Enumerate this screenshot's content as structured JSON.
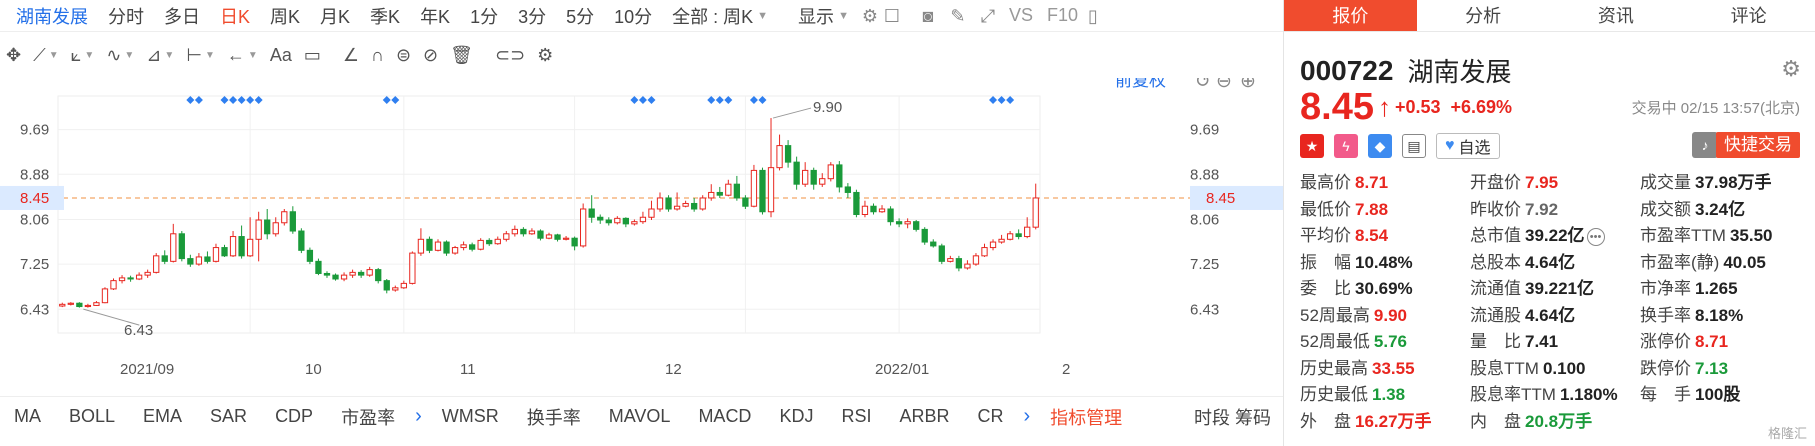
{
  "period_bar": {
    "stock_name": "湖南发展",
    "items": [
      "分时",
      "多日",
      "日K",
      "周K",
      "月K",
      "季K",
      "年K",
      "1分",
      "3分",
      "5分",
      "10分"
    ],
    "active": "日K",
    "adjust_select": "全部 : 周K",
    "display_label": "显示",
    "vs_label": "VS",
    "f10_label": "F10"
  },
  "toolbar": {
    "text_tool": "Aa"
  },
  "chart": {
    "adjust_label": "前复权",
    "y_ticks": [
      "9.69",
      "8.88",
      "8.06",
      "7.25",
      "6.43"
    ],
    "current_price": "8.45",
    "x_labels": [
      "2021/09",
      "10",
      "11",
      "12",
      "2022/01",
      "2"
    ],
    "high_marker": "9.90",
    "low_marker": "6.43"
  },
  "chart_data": {
    "type": "candlestick",
    "ylim": [
      6.0,
      10.3
    ],
    "reference_price": 8.45,
    "annotations": {
      "max": 9.9,
      "min": 6.43
    },
    "candles": [
      [
        6.49,
        6.52,
        6.47,
        6.55
      ],
      [
        6.52,
        6.54,
        6.5,
        6.56
      ],
      [
        6.54,
        6.48,
        6.46,
        6.56
      ],
      [
        6.48,
        6.5,
        6.46,
        6.53
      ],
      [
        6.5,
        6.55,
        6.49,
        6.58
      ],
      [
        6.55,
        6.8,
        6.54,
        6.83
      ],
      [
        6.8,
        6.95,
        6.78,
        6.99
      ],
      [
        6.95,
        7.0,
        6.9,
        7.05
      ],
      [
        7.0,
        6.98,
        6.93,
        7.04
      ],
      [
        6.98,
        7.05,
        6.96,
        7.1
      ],
      [
        7.05,
        7.1,
        7.0,
        7.15
      ],
      [
        7.1,
        7.4,
        7.08,
        7.45
      ],
      [
        7.4,
        7.3,
        7.25,
        7.5
      ],
      [
        7.3,
        7.8,
        7.28,
        7.98
      ],
      [
        7.8,
        7.35,
        7.3,
        7.85
      ],
      [
        7.35,
        7.25,
        7.2,
        7.42
      ],
      [
        7.25,
        7.38,
        7.22,
        7.45
      ],
      [
        7.38,
        7.3,
        7.26,
        7.48
      ],
      [
        7.3,
        7.55,
        7.28,
        7.62
      ],
      [
        7.55,
        7.4,
        7.38,
        7.6
      ],
      [
        7.4,
        7.75,
        7.38,
        7.85
      ],
      [
        7.75,
        7.4,
        7.35,
        7.95
      ],
      [
        7.4,
        7.7,
        7.38,
        8.1
      ],
      [
        7.7,
        8.05,
        7.3,
        8.2
      ],
      [
        8.05,
        7.8,
        7.7,
        8.25
      ],
      [
        7.8,
        8.0,
        7.75,
        8.1
      ],
      [
        8.0,
        8.2,
        7.95,
        8.25
      ],
      [
        8.2,
        7.85,
        7.8,
        8.3
      ],
      [
        7.85,
        7.5,
        7.45,
        7.9
      ],
      [
        7.5,
        7.3,
        7.25,
        7.55
      ],
      [
        7.3,
        7.08,
        7.05,
        7.35
      ],
      [
        7.08,
        7.05,
        7.0,
        7.12
      ],
      [
        7.05,
        6.98,
        6.95,
        7.08
      ],
      [
        6.98,
        7.05,
        6.94,
        7.1
      ],
      [
        7.05,
        7.1,
        7.0,
        7.15
      ],
      [
        7.1,
        7.05,
        7.0,
        7.14
      ],
      [
        7.05,
        7.15,
        7.02,
        7.2
      ],
      [
        7.15,
        6.95,
        6.9,
        7.18
      ],
      [
        6.95,
        6.78,
        6.72,
        6.98
      ],
      [
        6.78,
        6.82,
        6.75,
        6.86
      ],
      [
        6.82,
        6.9,
        6.8,
        6.95
      ],
      [
        6.9,
        7.45,
        6.88,
        7.48
      ],
      [
        7.45,
        7.7,
        7.4,
        7.9
      ],
      [
        7.7,
        7.5,
        7.45,
        7.75
      ],
      [
        7.5,
        7.65,
        7.48,
        7.7
      ],
      [
        7.65,
        7.45,
        7.4,
        7.68
      ],
      [
        7.45,
        7.55,
        7.42,
        7.58
      ],
      [
        7.55,
        7.6,
        7.5,
        7.66
      ],
      [
        7.6,
        7.52,
        7.48,
        7.64
      ],
      [
        7.52,
        7.68,
        7.5,
        7.72
      ],
      [
        7.68,
        7.62,
        7.58,
        7.72
      ],
      [
        7.62,
        7.7,
        7.6,
        7.75
      ],
      [
        7.7,
        7.8,
        7.66,
        7.85
      ],
      [
        7.8,
        7.88,
        7.75,
        7.95
      ],
      [
        7.88,
        7.8,
        7.75,
        7.92
      ],
      [
        7.8,
        7.85,
        7.78,
        7.9
      ],
      [
        7.85,
        7.72,
        7.68,
        7.88
      ],
      [
        7.72,
        7.78,
        7.7,
        7.82
      ],
      [
        7.78,
        7.7,
        7.66,
        7.8
      ],
      [
        7.7,
        7.72,
        7.68,
        7.76
      ],
      [
        7.72,
        7.58,
        7.5,
        7.75
      ],
      [
        7.58,
        8.25,
        7.55,
        8.35
      ],
      [
        8.25,
        8.1,
        8.0,
        8.5
      ],
      [
        8.1,
        8.05,
        7.98,
        8.15
      ],
      [
        8.05,
        8.0,
        7.95,
        8.1
      ],
      [
        8.0,
        8.08,
        7.97,
        8.12
      ],
      [
        8.08,
        7.98,
        7.92,
        8.1
      ],
      [
        7.98,
        8.02,
        7.95,
        8.06
      ],
      [
        8.02,
        8.1,
        7.98,
        8.2
      ],
      [
        8.1,
        8.25,
        8.05,
        8.4
      ],
      [
        8.25,
        8.45,
        8.2,
        8.55
      ],
      [
        8.45,
        8.25,
        8.2,
        8.5
      ],
      [
        8.25,
        8.3,
        8.22,
        8.55
      ],
      [
        8.3,
        8.35,
        8.28,
        8.4
      ],
      [
        8.35,
        8.25,
        8.2,
        8.45
      ],
      [
        8.25,
        8.45,
        8.22,
        8.5
      ],
      [
        8.45,
        8.55,
        8.4,
        8.7
      ],
      [
        8.55,
        8.5,
        8.45,
        8.65
      ],
      [
        8.5,
        8.7,
        8.48,
        8.78
      ],
      [
        8.7,
        8.45,
        8.4,
        8.85
      ],
      [
        8.45,
        8.3,
        8.25,
        8.5
      ],
      [
        8.3,
        8.95,
        8.28,
        9.05
      ],
      [
        8.95,
        8.2,
        8.15,
        9.0
      ],
      [
        8.2,
        9.0,
        8.1,
        9.9
      ],
      [
        9.0,
        9.4,
        8.95,
        9.6
      ],
      [
        9.4,
        9.1,
        9.0,
        9.5
      ],
      [
        9.1,
        8.7,
        8.6,
        9.2
      ],
      [
        8.7,
        8.95,
        8.65,
        9.1
      ],
      [
        8.95,
        8.7,
        8.6,
        9.0
      ],
      [
        8.7,
        8.8,
        8.65,
        8.9
      ],
      [
        8.8,
        9.05,
        8.75,
        9.1
      ],
      [
        9.05,
        8.65,
        8.55,
        9.12
      ],
      [
        8.65,
        8.55,
        8.45,
        8.72
      ],
      [
        8.55,
        8.15,
        8.1,
        8.6
      ],
      [
        8.15,
        8.3,
        8.1,
        8.4
      ],
      [
        8.3,
        8.2,
        8.15,
        8.35
      ],
      [
        8.2,
        8.25,
        8.18,
        8.32
      ],
      [
        8.25,
        8.02,
        7.95,
        8.3
      ],
      [
        8.02,
        7.98,
        7.92,
        8.08
      ],
      [
        7.98,
        8.02,
        7.9,
        8.08
      ],
      [
        8.02,
        7.88,
        7.84,
        8.05
      ],
      [
        7.88,
        7.65,
        7.6,
        7.92
      ],
      [
        7.65,
        7.58,
        7.55,
        7.7
      ],
      [
        7.58,
        7.3,
        7.25,
        7.62
      ],
      [
        7.3,
        7.35,
        7.28,
        7.4
      ],
      [
        7.35,
        7.18,
        7.12,
        7.4
      ],
      [
        7.18,
        7.25,
        7.15,
        7.32
      ],
      [
        7.25,
        7.4,
        7.22,
        7.45
      ],
      [
        7.4,
        7.55,
        7.38,
        7.62
      ],
      [
        7.55,
        7.65,
        7.5,
        7.7
      ],
      [
        7.65,
        7.7,
        7.62,
        7.78
      ],
      [
        7.7,
        7.8,
        7.68,
        7.85
      ],
      [
        7.8,
        7.75,
        7.7,
        7.88
      ],
      [
        7.75,
        7.92,
        7.72,
        8.1
      ],
      [
        7.92,
        8.45,
        7.88,
        8.71
      ]
    ],
    "signal_markers_x_index": [
      15,
      16,
      19,
      20,
      21,
      22,
      23,
      38,
      39,
      67,
      68,
      69,
      76,
      77,
      78,
      81,
      82,
      109,
      110,
      111
    ]
  },
  "indicators": {
    "items": [
      "MA",
      "BOLL",
      "EMA",
      "SAR",
      "CDP",
      "市盈率"
    ],
    "items2": [
      "WMSR",
      "换手率",
      "MAVOL",
      "MACD",
      "KDJ",
      "RSI",
      "ARBR",
      "CR"
    ],
    "manage": "指标管理",
    "right": "时段 筹码"
  },
  "panel": {
    "tabs": [
      "报价",
      "分析",
      "资讯",
      "评论"
    ],
    "code": "000722",
    "name": "湖南发展",
    "price": "8.45",
    "change": "+0.53",
    "change_pct": "+6.69%",
    "status": "交易中 02/15 13:57(北京)",
    "watch_label": "自选",
    "quick_trade": "快捷交易",
    "watermark": "格隆汇",
    "quotes": [
      {
        "label": "最高价",
        "value": "8.71",
        "color": "red"
      },
      {
        "label": "开盘价",
        "value": "7.95",
        "color": "red"
      },
      {
        "label": "成交量",
        "value": "37.98万手",
        "color": "dark"
      },
      {
        "label": "最低价",
        "value": "7.88",
        "color": "red"
      },
      {
        "label": "昨收价",
        "value": "7.92",
        "color": "gray"
      },
      {
        "label": "成交额",
        "value": "3.24亿",
        "color": "dark"
      },
      {
        "label": "平均价",
        "value": "8.54",
        "color": "red"
      },
      {
        "label": "总市值",
        "value": "39.22亿",
        "color": "dark"
      },
      {
        "label": "市盈率TTM",
        "value": "35.50",
        "color": "dark"
      },
      {
        "label": "振　幅",
        "value": "10.48%",
        "color": "dark"
      },
      {
        "label": "总股本",
        "value": "4.64亿",
        "color": "dark"
      },
      {
        "label": "市盈率(静)",
        "value": "40.05",
        "color": "dark"
      },
      {
        "label": "委　比",
        "value": "30.69%",
        "color": "dark"
      },
      {
        "label": "流通值",
        "value": "39.221亿",
        "color": "dark"
      },
      {
        "label": "市净率",
        "value": "1.265",
        "color": "dark"
      },
      {
        "label": "52周最高",
        "value": "9.90",
        "color": "red"
      },
      {
        "label": "流通股",
        "value": "4.64亿",
        "color": "dark"
      },
      {
        "label": "换手率",
        "value": "8.18%",
        "color": "dark"
      },
      {
        "label": "52周最低",
        "value": "5.76",
        "color": "green"
      },
      {
        "label": "量　比",
        "value": "7.41",
        "color": "dark"
      },
      {
        "label": "涨停价",
        "value": "8.71",
        "color": "red"
      },
      {
        "label": "历史最高",
        "value": "33.55",
        "color": "red"
      },
      {
        "label": "股息TTM",
        "value": "0.100",
        "color": "dark"
      },
      {
        "label": "跌停价",
        "value": "7.13",
        "color": "green"
      },
      {
        "label": "历史最低",
        "value": "1.38",
        "color": "green"
      },
      {
        "label": "股息率TTM",
        "value": "1.180%",
        "color": "dark"
      },
      {
        "label": "每　手",
        "value": "100股",
        "color": "dark"
      },
      {
        "label": "外　盘",
        "value": "16.27万手",
        "color": "red"
      },
      {
        "label": "内　盘",
        "value": "20.8万手",
        "color": "green"
      },
      {
        "label": "",
        "value": "",
        "color": "dark"
      }
    ]
  }
}
